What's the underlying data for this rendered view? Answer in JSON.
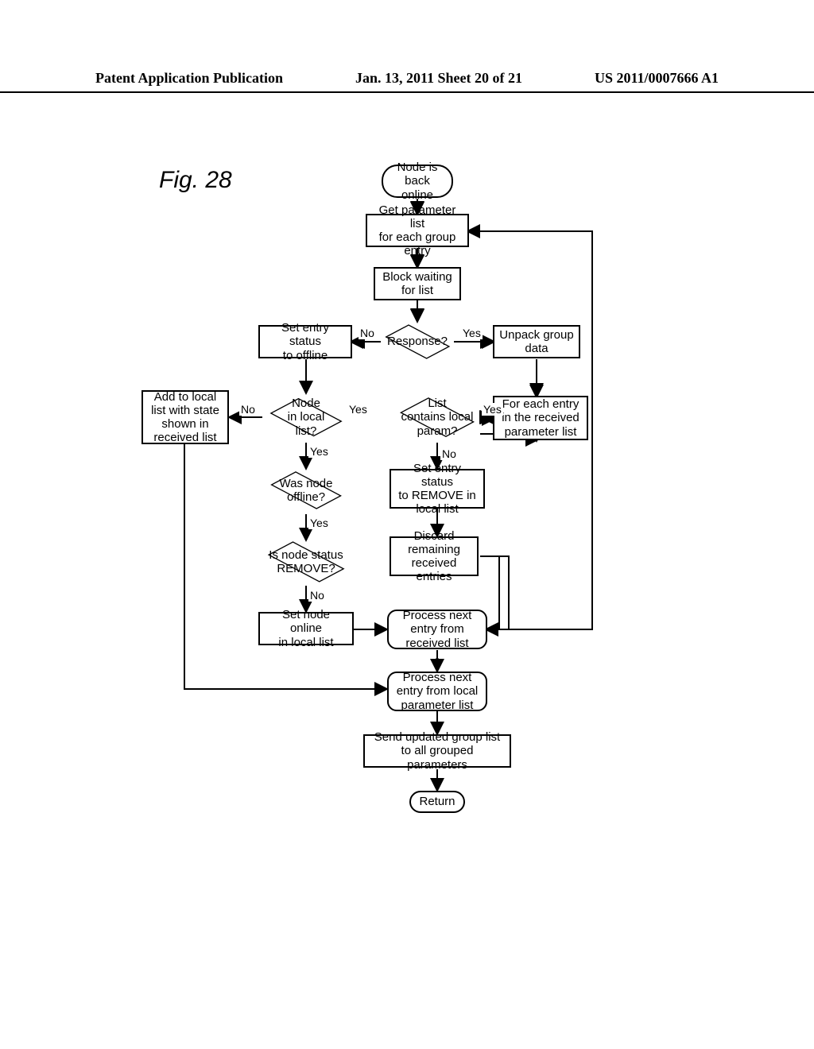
{
  "header": {
    "left": "Patent Application Publication",
    "center": "Jan. 13, 2011  Sheet 20 of 21",
    "right": "US 2011/0007666 A1"
  },
  "figure_label": "Fig. 28",
  "nodes": {
    "start": "Node is\nback online",
    "get_param": "Get parameter list\nfor each group entry",
    "block_wait": "Block waiting\nfor list",
    "response": "Response?",
    "set_offline": "Set entry status\nto offline",
    "unpack": "Unpack group\ndata",
    "for_each": "For each entry\nin the received\nparameter list",
    "list_contains": "List\ncontains local\nparam?",
    "node_in_list": "Node\nin local\nlist?",
    "add_local": "Add to local\nlist with state\nshown in\nreceived list",
    "set_remove": "Set entry status\nto REMOVE in\nlocal list",
    "was_offline": "Was node\noffline?",
    "discard": "Discard\nremaining\nreceived entries",
    "is_remove": "Is node status\nREMOVE?",
    "set_online": "Set node online\nin local list",
    "proc_next_recv": "Process next\nentry from\nreceived list",
    "proc_next_loc": "Process next\nentry from local\nparameter list",
    "send_updated": "Send updated group list\nto all grouped parameters",
    "return": "Return"
  },
  "edge_labels": {
    "no": "No",
    "yes": "Yes"
  },
  "chart_data": {
    "type": "flowchart",
    "title": "Fig. 28",
    "nodes": [
      {
        "id": "start",
        "type": "terminator",
        "label": "Node is back online"
      },
      {
        "id": "get_param",
        "type": "process",
        "label": "Get parameter list for each group entry"
      },
      {
        "id": "block_wait",
        "type": "process",
        "label": "Block waiting for list"
      },
      {
        "id": "response",
        "type": "decision",
        "label": "Response?"
      },
      {
        "id": "set_offline",
        "type": "process",
        "label": "Set entry status to offline"
      },
      {
        "id": "unpack",
        "type": "process",
        "label": "Unpack group data"
      },
      {
        "id": "for_each",
        "type": "process",
        "label": "For each entry in the received parameter list"
      },
      {
        "id": "list_contains",
        "type": "decision",
        "label": "List contains local param?"
      },
      {
        "id": "node_in_list",
        "type": "decision",
        "label": "Node in local list?"
      },
      {
        "id": "add_local",
        "type": "process",
        "label": "Add to local list with state shown in received list"
      },
      {
        "id": "set_remove",
        "type": "process",
        "label": "Set entry status to REMOVE in local list"
      },
      {
        "id": "was_offline",
        "type": "decision",
        "label": "Was node offline?"
      },
      {
        "id": "discard",
        "type": "process",
        "label": "Discard remaining received entries"
      },
      {
        "id": "is_remove",
        "type": "decision",
        "label": "Is node status REMOVE?"
      },
      {
        "id": "set_online",
        "type": "process",
        "label": "Set node online in local list"
      },
      {
        "id": "proc_next_recv",
        "type": "subroutine",
        "label": "Process next entry from received list"
      },
      {
        "id": "proc_next_loc",
        "type": "subroutine",
        "label": "Process next entry from local parameter list"
      },
      {
        "id": "send_updated",
        "type": "process",
        "label": "Send updated group list to all grouped parameters"
      },
      {
        "id": "return",
        "type": "terminator",
        "label": "Return"
      }
    ],
    "edges": [
      {
        "from": "start",
        "to": "get_param"
      },
      {
        "from": "get_param",
        "to": "block_wait"
      },
      {
        "from": "block_wait",
        "to": "response"
      },
      {
        "from": "response",
        "to": "set_offline",
        "label": "No"
      },
      {
        "from": "response",
        "to": "unpack",
        "label": "Yes"
      },
      {
        "from": "unpack",
        "to": "for_each"
      },
      {
        "from": "for_each",
        "to": "list_contains"
      },
      {
        "from": "list_contains",
        "to": "for_each",
        "label": "Yes"
      },
      {
        "from": "list_contains",
        "to": "set_remove",
        "label": "No"
      },
      {
        "from": "set_offline",
        "to": "node_in_list"
      },
      {
        "from": "node_in_list",
        "to": "add_local",
        "label": "No"
      },
      {
        "from": "node_in_list",
        "to": "was_offline",
        "label": "Yes"
      },
      {
        "from": "was_offline",
        "to": "is_remove",
        "label": "Yes"
      },
      {
        "from": "is_remove",
        "to": "set_online",
        "label": "No"
      },
      {
        "from": "set_online",
        "to": "proc_next_recv"
      },
      {
        "from": "set_remove",
        "to": "discard"
      },
      {
        "from": "discard",
        "to": "proc_next_recv"
      },
      {
        "from": "proc_next_recv",
        "to": "proc_next_loc"
      },
      {
        "from": "proc_next_recv",
        "to": "get_param"
      },
      {
        "from": "add_local",
        "to": "proc_next_loc"
      },
      {
        "from": "proc_next_loc",
        "to": "send_updated"
      },
      {
        "from": "send_updated",
        "to": "return"
      }
    ]
  }
}
